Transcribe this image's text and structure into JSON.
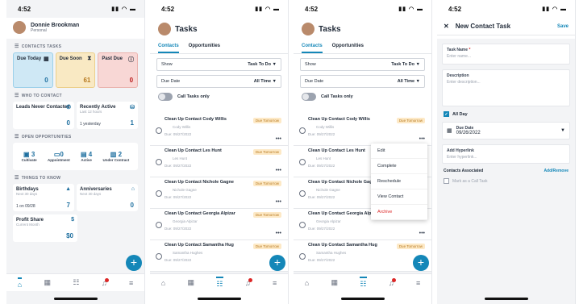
{
  "status_time": "4:52",
  "dashboard": {
    "user_name": "Donnie Brookman",
    "user_role": "Personal",
    "contacts_tasks_label": "CONTACTS TASKS",
    "tiles": [
      {
        "label": "Due Today",
        "value": "0"
      },
      {
        "label": "Due Soon",
        "value": "61"
      },
      {
        "label": "Past Due",
        "value": "0"
      }
    ],
    "who_label": "WHO TO CONTACT",
    "leads_label": "Leads Never Contacted",
    "leads_value": "0",
    "recent_label": "Recently Active",
    "recent_sub": "Last 12 hours",
    "recent_extra": "1 yesterday",
    "recent_value": "1",
    "opps_label": "OPEN OPPORTUNITIES",
    "opps": [
      {
        "value": "3",
        "label": "Cultivate"
      },
      {
        "value": "0",
        "label": "Appointment"
      },
      {
        "value": "4",
        "label": "Active"
      },
      {
        "value": "2",
        "label": "Under Contract"
      }
    ],
    "things_label": "THINGS TO KNOW",
    "birthdays_label": "Birthdays",
    "birthdays_sub": "Next 30 days",
    "birthdays_extra": "1 on 09/28",
    "birthdays_value": "7",
    "anniv_label": "Anniversaries",
    "anniv_sub": "Next 30 days",
    "anniv_value": "0",
    "profit_label": "Profit Share",
    "profit_sub": "Current Month",
    "profit_value": "$0"
  },
  "tasks": {
    "title": "Tasks",
    "tab_contacts": "Contacts",
    "tab_opps": "Opportunities",
    "show_label": "Show",
    "show_value": "Task To Do",
    "due_label": "Due Date",
    "due_value": "All Time",
    "call_only": "Call Tasks only",
    "items": [
      {
        "title": "Clean Up Contact Cody Willis",
        "who": "Cody Willis",
        "date": "Due: 09/27/2022",
        "tag": "Due Tomorrow"
      },
      {
        "title": "Clean Up Contact Les Hunt",
        "who": "Les Hunt",
        "date": "Due: 09/27/2022",
        "tag": "Due Tomorrow"
      },
      {
        "title": "Clean Up Contact Nichole Gagne",
        "who": "Nichole Gagne",
        "date": "Due: 09/27/2022",
        "tag": "Due Tomorrow"
      },
      {
        "title": "Clean Up Contact Georgia Alpizar",
        "who": "Georgia Alpizar",
        "date": "Due: 09/27/2022",
        "tag": "Due Tomorrow"
      },
      {
        "title": "Clean Up Contact Samantha Hug",
        "who": "Samantha Hughes",
        "date": "Due: 09/27/2022",
        "tag": "Due Tomorrow"
      }
    ],
    "menu": [
      "Edit",
      "Complete",
      "Reschedule",
      "View Contact",
      "Archive"
    ]
  },
  "new_task": {
    "title": "New Contact Task",
    "save": "Save",
    "task_name_label": "Task Name",
    "task_name_ph": "Enter name...",
    "desc_label": "Description",
    "desc_ph": "Enter description...",
    "all_day": "All Day",
    "due_label": "Due Date",
    "due_value": "09/26/2022",
    "hyper_label": "Add Hyperlink",
    "hyper_ph": "Enter hyperlink...",
    "assoc_label": "Contacts Associated",
    "assoc_link": "Add/Remove",
    "call_task": "Mark as a Call Task"
  }
}
